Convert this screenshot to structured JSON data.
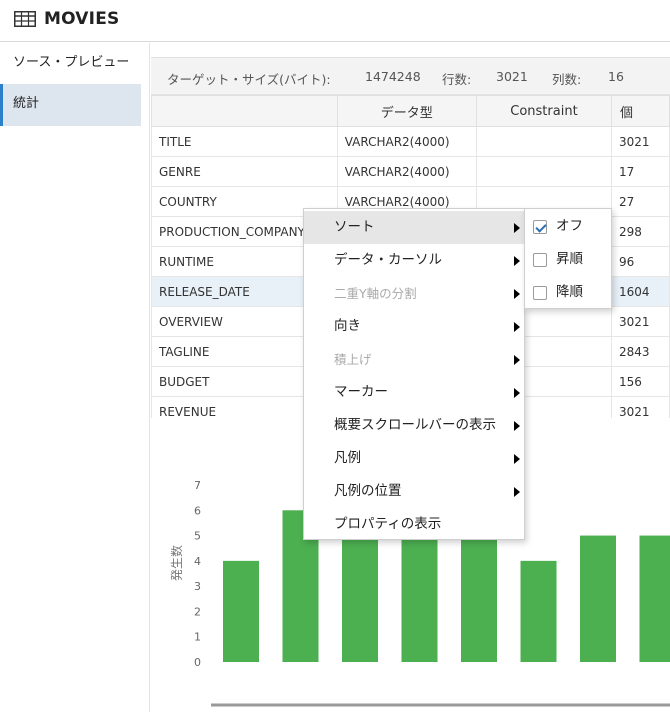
{
  "header": {
    "title": "MOVIES",
    "icon": "table-icon"
  },
  "nav": {
    "items": [
      {
        "label": "ソース・プレビュー",
        "active": false
      },
      {
        "label": "統計",
        "active": true
      }
    ]
  },
  "info": {
    "target_size_label": "ターゲット・サイズ(バイト):",
    "target_size_value": "1474248",
    "rows_label": "行数:",
    "rows_value": "3021",
    "cols_label": "列数:",
    "cols_value": "16"
  },
  "grid": {
    "columns": [
      "",
      "データ型",
      "Constraint",
      "個"
    ],
    "rows": [
      {
        "name": "TITLE",
        "type": "VARCHAR2(4000)",
        "constraint": "",
        "count": "3021"
      },
      {
        "name": "GENRE",
        "type": "VARCHAR2(4000)",
        "constraint": "",
        "count": "17"
      },
      {
        "name": "COUNTRY",
        "type": "VARCHAR2(4000)",
        "constraint": "",
        "count": "27"
      },
      {
        "name": "PRODUCTION_COMPANY",
        "type": "",
        "constraint": "",
        "count": "298"
      },
      {
        "name": "RUNTIME",
        "type": "",
        "constraint": "",
        "count": "96"
      },
      {
        "name": "RELEASE_DATE",
        "type": "",
        "constraint": "",
        "count": "1604"
      },
      {
        "name": "OVERVIEW",
        "type": "",
        "constraint": "",
        "count": "3021"
      },
      {
        "name": "TAGLINE",
        "type": "",
        "constraint": "",
        "count": "2843"
      },
      {
        "name": "BUDGET",
        "type": "",
        "constraint": "",
        "count": "156"
      },
      {
        "name": "REVENUE",
        "type": "",
        "constraint": "",
        "count": "3021"
      }
    ],
    "highlight_row": "RELEASE_DATE"
  },
  "context_menu": {
    "items": [
      {
        "label": "ソート",
        "submenu": true,
        "disabled": false,
        "hover": true
      },
      {
        "label": "データ・カーソル",
        "submenu": true,
        "disabled": false,
        "hover": false
      },
      {
        "label": "二重Y軸の分割",
        "submenu": true,
        "disabled": true,
        "hover": false
      },
      {
        "label": "向き",
        "submenu": true,
        "disabled": false,
        "hover": false
      },
      {
        "label": "積上げ",
        "submenu": true,
        "disabled": true,
        "hover": false
      },
      {
        "label": "マーカー",
        "submenu": true,
        "disabled": false,
        "hover": false
      },
      {
        "label": "概要スクロールバーの表示",
        "submenu": true,
        "disabled": false,
        "hover": false
      },
      {
        "label": "凡例",
        "submenu": true,
        "disabled": false,
        "hover": false
      },
      {
        "label": "凡例の位置",
        "submenu": true,
        "disabled": false,
        "hover": false
      },
      {
        "label": "プロパティの表示",
        "submenu": false,
        "disabled": false,
        "hover": false
      }
    ]
  },
  "sort_submenu": {
    "items": [
      {
        "label": "オフ",
        "checked": true
      },
      {
        "label": "昇順",
        "checked": false
      },
      {
        "label": "降順",
        "checked": false
      }
    ]
  },
  "chart_data": {
    "type": "bar",
    "ylabel": "発生数",
    "ylim": [
      0,
      7
    ],
    "yticks": [
      "0",
      "1",
      "2",
      "3",
      "4",
      "5",
      "6",
      "7"
    ],
    "values": [
      4,
      6,
      5,
      5,
      5,
      4,
      5,
      5
    ],
    "bar_color": "#4caf50",
    "grid": false
  },
  "colors": {
    "accent": "#2c80c9",
    "active_nav_bg": "#dde5ee",
    "bar": "#4caf50",
    "highlight_row": "#e8f0f8"
  }
}
